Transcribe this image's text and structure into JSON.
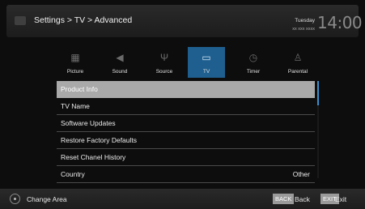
{
  "header": {
    "breadcrumb": "Settings > TV > Advanced",
    "day": "Tuesday",
    "date": "xx xxx xxxx",
    "time": "14:00"
  },
  "categories": [
    {
      "label": "Picture",
      "icon": "picture-icon",
      "selected": false
    },
    {
      "label": "Sound",
      "icon": "sound-icon",
      "selected": false
    },
    {
      "label": "Source",
      "icon": "antenna-icon",
      "selected": false
    },
    {
      "label": "TV",
      "icon": "tv-icon",
      "selected": true
    },
    {
      "label": "Timer",
      "icon": "timer-icon",
      "selected": false
    },
    {
      "label": "Parental",
      "icon": "parental-icon",
      "selected": false
    }
  ],
  "menu": {
    "items": [
      {
        "label": "Product Info",
        "value": "",
        "selected": true
      },
      {
        "label": "TV Name",
        "value": "",
        "selected": false
      },
      {
        "label": "Software Updates",
        "value": "",
        "selected": false
      },
      {
        "label": "Restore Factory Defaults",
        "value": "",
        "selected": false
      },
      {
        "label": "Reset Chanel History",
        "value": "",
        "selected": false
      },
      {
        "label": "Country",
        "value": "Other",
        "selected": false
      }
    ]
  },
  "footer": {
    "change_area": "Change Area",
    "back_key": "BACK",
    "back_label": "Back",
    "exit_key": "EXIT",
    "exit_label": "Exit"
  },
  "colors": {
    "accent": "#1f5f8f",
    "selected_row": "#a9a9a9",
    "scroll_thumb": "#3b8ed0"
  }
}
